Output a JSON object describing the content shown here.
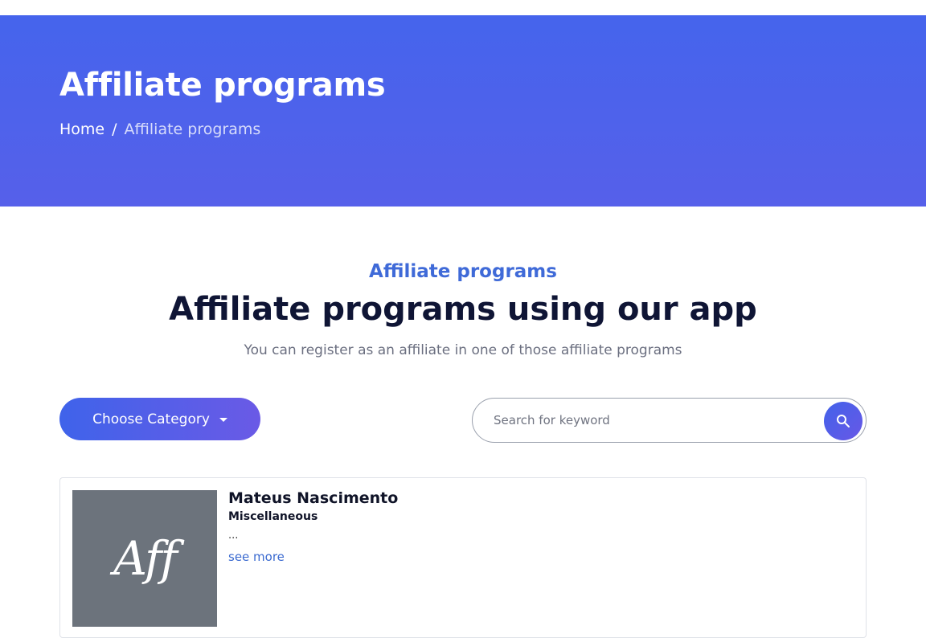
{
  "hero": {
    "title": "Affiliate programs",
    "breadcrumb": {
      "home": "Home",
      "separator": "/",
      "current": "Affiliate programs"
    }
  },
  "section": {
    "eyebrow": "Affiliate programs",
    "title": "Affiliate programs using our app",
    "subtitle": "You can register as an affiliate in one of those affiliate programs"
  },
  "filters": {
    "category_label": "Choose Category",
    "search_placeholder": "Search for keyword",
    "search_value": ""
  },
  "programs": [
    {
      "thumb_text": "Aff",
      "name": "Mateus Nascimento",
      "category": "Miscellaneous",
      "description": "...",
      "more_label": "see more"
    }
  ],
  "colors": {
    "hero_bg": "#4a62ec",
    "accent": "#3f6ad8",
    "thumb_bg": "#6c737c"
  },
  "icons": {
    "search": "search-icon",
    "caret": "chevron-down-icon"
  }
}
